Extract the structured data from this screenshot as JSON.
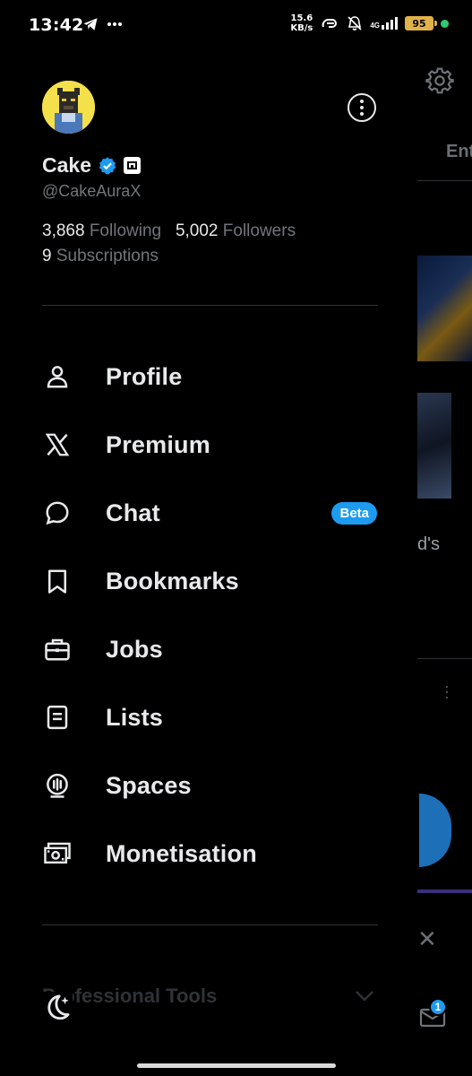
{
  "status_bar": {
    "time": "13:42",
    "speed": "15.6",
    "speed_unit": "KB/s",
    "network": "4G",
    "battery": "95",
    "icons": [
      "telegram-icon",
      "more-dots-icon",
      "hotspot-icon",
      "mute-bell-icon",
      "signal-icon",
      "battery-icon"
    ]
  },
  "profile": {
    "display_name": "Cake",
    "handle": "@CakeAuraX",
    "following_count": "3,868",
    "following_label": "Following",
    "followers_count": "5,002",
    "followers_label": "Followers",
    "subscriptions_count": "9",
    "subscriptions_label": "Subscriptions",
    "verified_color": "#1d9bf0"
  },
  "menu": {
    "items": [
      {
        "label": "Profile",
        "icon": "person-icon"
      },
      {
        "label": "Premium",
        "icon": "x-logo-icon"
      },
      {
        "label": "Chat",
        "icon": "chat-bubble-icon",
        "badge": "Beta"
      },
      {
        "label": "Bookmarks",
        "icon": "bookmark-icon"
      },
      {
        "label": "Jobs",
        "icon": "briefcase-icon"
      },
      {
        "label": "Lists",
        "icon": "list-icon"
      },
      {
        "label": "Spaces",
        "icon": "spaces-icon"
      },
      {
        "label": "Monetisation",
        "icon": "money-icon"
      }
    ]
  },
  "footer": {
    "professional_tools": "Professional Tools"
  },
  "background": {
    "tab_fragment": "Ent",
    "text_fragment": "d's",
    "mail_badge": "1"
  },
  "colors": {
    "background": "#000000",
    "text": "#e7e9ea",
    "muted": "#71767b",
    "accent": "#1d9bf0",
    "divider": "#2f3336"
  }
}
